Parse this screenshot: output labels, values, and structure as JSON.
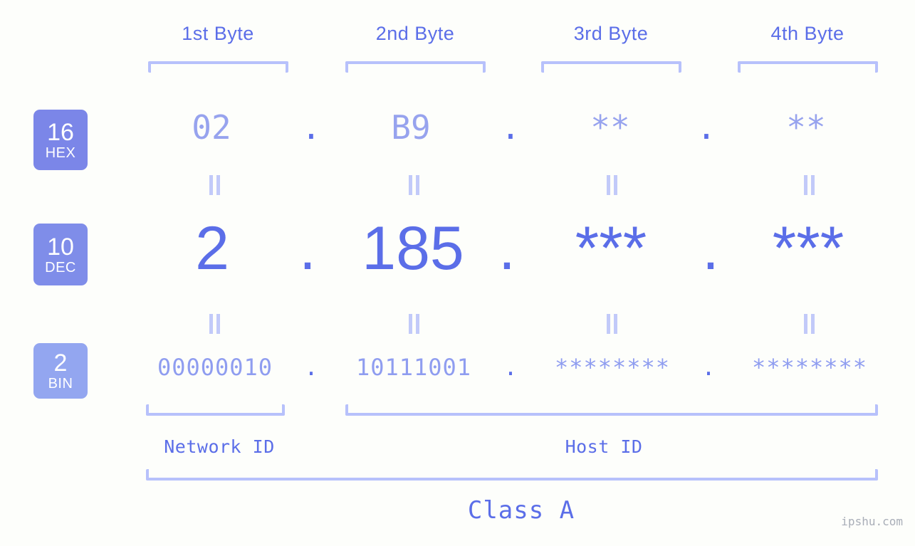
{
  "background_color": "#fdfefb",
  "accent_color": "#5b6ee8",
  "accent_light_color": "#97a3ee",
  "bracket_color": "#b7c1fb",
  "badge_color": "#7b86e8",
  "byte_headers": [
    {
      "label": "1st Byte"
    },
    {
      "label": "2nd Byte"
    },
    {
      "label": "3rd Byte"
    },
    {
      "label": "4th Byte"
    }
  ],
  "bases": [
    {
      "number": "16",
      "name": "HEX",
      "color": "#7b86e8"
    },
    {
      "number": "10",
      "name": "DEC",
      "color": "#7f8de9"
    },
    {
      "number": "2",
      "name": "BIN",
      "color": "#93a6f0"
    }
  ],
  "rows": {
    "hex": {
      "values": [
        "02",
        "B9",
        "**",
        "**"
      ],
      "separator": "."
    },
    "dec": {
      "values": [
        "2",
        "185",
        "***",
        "***"
      ],
      "separator": "."
    },
    "bin": {
      "values": [
        "00000010",
        "10111001",
        "********",
        "********"
      ],
      "separator": "."
    }
  },
  "equals_symbol": "||",
  "sections": [
    {
      "label": "Network ID"
    },
    {
      "label": "Host ID"
    }
  ],
  "class": {
    "label": "Class A"
  },
  "watermark": {
    "text": "ipshu.com"
  }
}
